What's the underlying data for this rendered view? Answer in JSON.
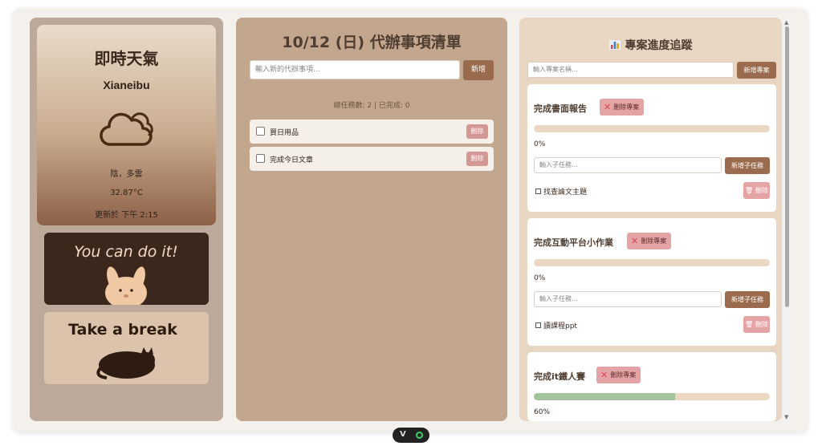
{
  "weather": {
    "title": "即時天氣",
    "city": "Xianeibu",
    "icon": "cloud-icon",
    "description": "陰，多雲",
    "temperature": "32.87°C",
    "updated": "更新於 下午 2:15"
  },
  "cards": [
    {
      "text": "You can do it!",
      "icon": "bunny-icon"
    },
    {
      "text": "Take a break",
      "icon": "sleeping-cat-icon"
    }
  ],
  "todo": {
    "title": "10/12 (日) 代辦事項清單",
    "input_placeholder": "輸入新的代辦事項...",
    "add_label": "新增",
    "stats": "總任務數: 2 | 已完成: 0",
    "items": [
      {
        "text": "買日用品",
        "delete_label": "刪除",
        "done": false
      },
      {
        "text": "完成今日文章",
        "delete_label": "刪除",
        "done": false
      }
    ]
  },
  "projects": {
    "title": "專案進度追蹤",
    "title_icon": "bar-chart-icon",
    "input_placeholder": "輸入專案名稱...",
    "add_label": "新增專案",
    "list": [
      {
        "name": "完成書面報告",
        "delete_label": "刪除專案",
        "progress": 0,
        "percent_text": "0%",
        "sub_placeholder": "輸入子任務...",
        "sub_add_label": "新增子任務",
        "subtasks": [
          {
            "text": "找查論文主題",
            "delete_label": "刪除"
          }
        ]
      },
      {
        "name": "完成互動平台小作業",
        "delete_label": "刪除專案",
        "progress": 0,
        "percent_text": "0%",
        "sub_placeholder": "輸入子任務...",
        "sub_add_label": "新增子任務",
        "subtasks": [
          {
            "text": "讀課程ppt",
            "delete_label": "刪除"
          }
        ]
      },
      {
        "name": "完成it鐵人賽",
        "delete_label": "刪除專案",
        "progress": 0.6,
        "percent_text": "60%"
      }
    ]
  },
  "colors": {
    "accent_brown": "#9a6c4d",
    "delete_pink": "#e4a3a5",
    "progress_green": "#a3c49e"
  }
}
